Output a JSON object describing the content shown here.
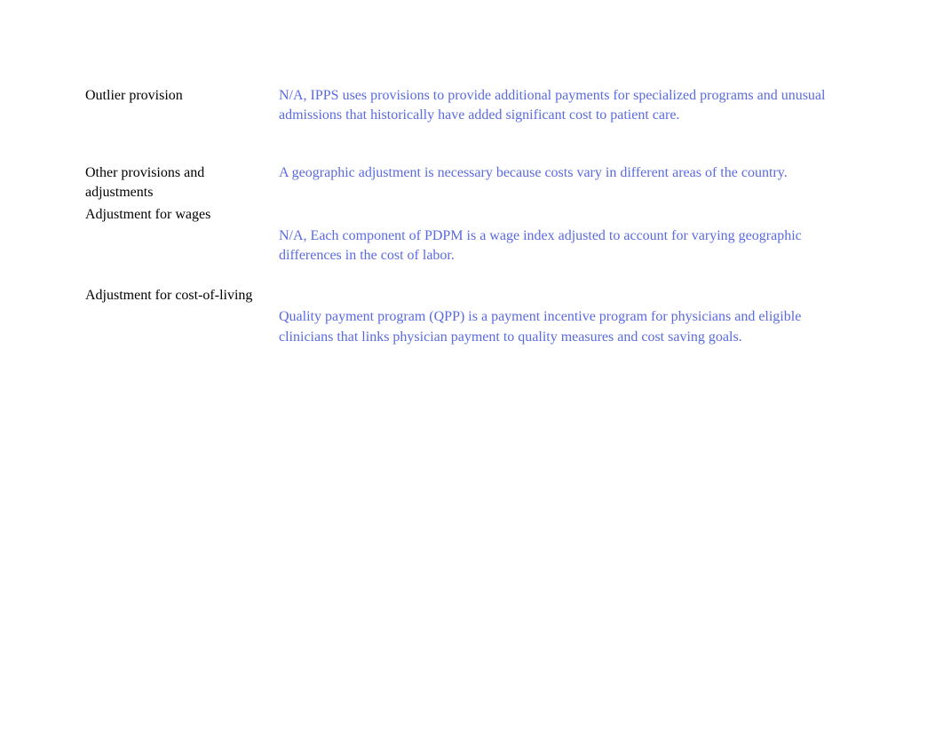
{
  "rows": [
    {
      "label": "Outlier provision",
      "desc": "N/A, IPPS uses provisions to provide additional payments for specialized programs and unusual admissions that historically have added significant cost to patient care.",
      "spacer": "spacer-medium"
    },
    {
      "label": "Other provisions and adjustments",
      "desc": "A geographic adjustment is necessary because costs vary in different areas of the country.",
      "spacer": "spacer-after-other"
    },
    {
      "label": "Adjustment for wages",
      "desc": "",
      "spacer": ""
    },
    {
      "label": "",
      "desc": "N/A, Each component of PDPM is a wage index adjusted to account for varying geographic differences in the cost of labor.",
      "spacer": "spacer-small"
    },
    {
      "label": "Adjustment for cost-of-living",
      "desc": "",
      "spacer": ""
    },
    {
      "label": "",
      "desc": "Quality payment program (QPP) is a payment incentive program for physicians and eligible clinicians that links physician payment to quality measures and cost saving goals.",
      "spacer": ""
    }
  ]
}
